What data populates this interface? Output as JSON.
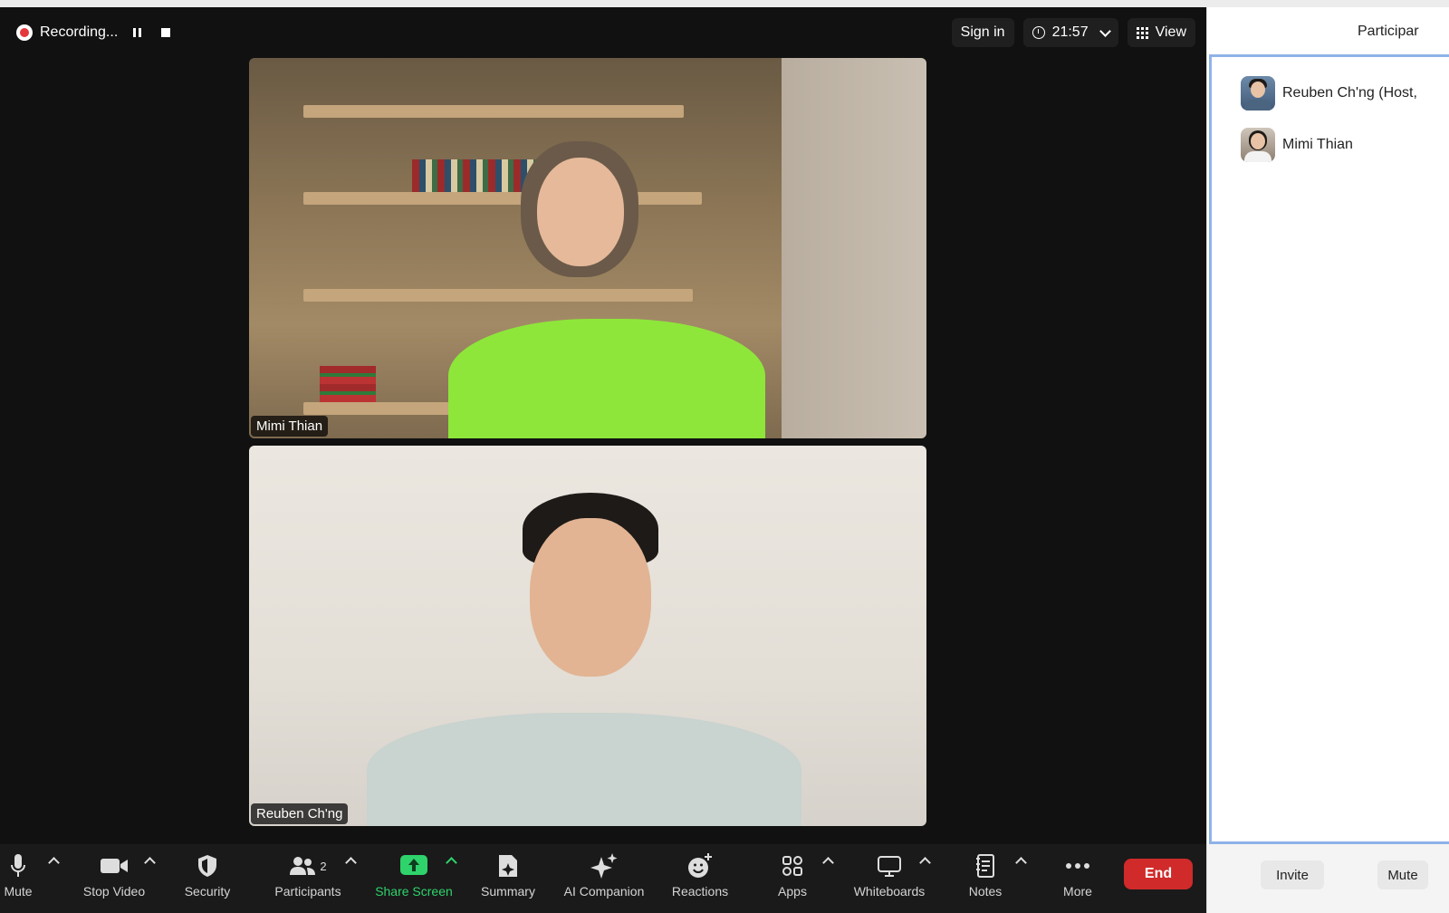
{
  "recording": {
    "label": "Recording..."
  },
  "topbar": {
    "sign_in": "Sign in",
    "elapsed": "21:57",
    "view_label": "View"
  },
  "tiles": [
    {
      "name": "Mimi Thian"
    },
    {
      "name": "Reuben Ch'ng"
    }
  ],
  "toolbar": {
    "mute": "Mute",
    "stop_video": "Stop Video",
    "security": "Security",
    "participants": "Participants",
    "participants_count": "2",
    "share_screen": "Share Screen",
    "summary": "Summary",
    "ai_companion": "AI Companion",
    "reactions": "Reactions",
    "apps": "Apps",
    "whiteboards": "Whiteboards",
    "notes": "Notes",
    "more": "More",
    "end": "End"
  },
  "panel": {
    "title": "Participar",
    "participants": [
      {
        "name": "Reuben Ch'ng (Host,"
      },
      {
        "name": "Mimi Thian"
      }
    ],
    "invite": "Invite",
    "mute": "Mute"
  },
  "colors": {
    "share_green": "#2fd36b",
    "end_red": "#d02a2a",
    "panel_focus": "#8fb2e8"
  }
}
